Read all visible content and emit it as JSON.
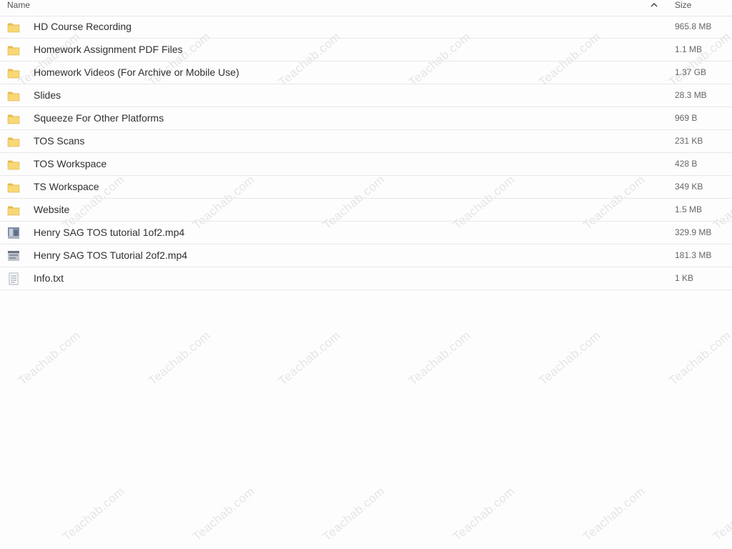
{
  "header": {
    "name_label": "Name",
    "size_label": "Size",
    "sort_icon": "chevron-up-icon"
  },
  "watermark_text": "Teachab.com",
  "files": [
    {
      "name": "HD Course Recording",
      "size": "965.8 MB",
      "type": "folder"
    },
    {
      "name": "Homework Assignment PDF Files",
      "size": "1.1 MB",
      "type": "folder"
    },
    {
      "name": "Homework Videos (For Archive or Mobile Use)",
      "size": "1.37 GB",
      "type": "folder"
    },
    {
      "name": "Slides",
      "size": "28.3 MB",
      "type": "folder"
    },
    {
      "name": "Squeeze For Other Platforms",
      "size": "969 B",
      "type": "folder"
    },
    {
      "name": "TOS Scans",
      "size": "231 KB",
      "type": "folder"
    },
    {
      "name": "TOS Workspace",
      "size": "428 B",
      "type": "folder"
    },
    {
      "name": "TS Workspace",
      "size": "349 KB",
      "type": "folder"
    },
    {
      "name": "Website",
      "size": "1.5 MB",
      "type": "folder"
    },
    {
      "name": "Henry SAG TOS tutorial 1of2.mp4",
      "size": "329.9 MB",
      "type": "video-a"
    },
    {
      "name": "Henry SAG TOS Tutorial 2of2.mp4",
      "size": "181.3 MB",
      "type": "video-b"
    },
    {
      "name": "Info.txt",
      "size": "1 KB",
      "type": "text"
    }
  ],
  "colors": {
    "folder_fill": "#f8d775",
    "folder_tab": "#e8bd4f",
    "row_border": "#e8e8e8"
  }
}
